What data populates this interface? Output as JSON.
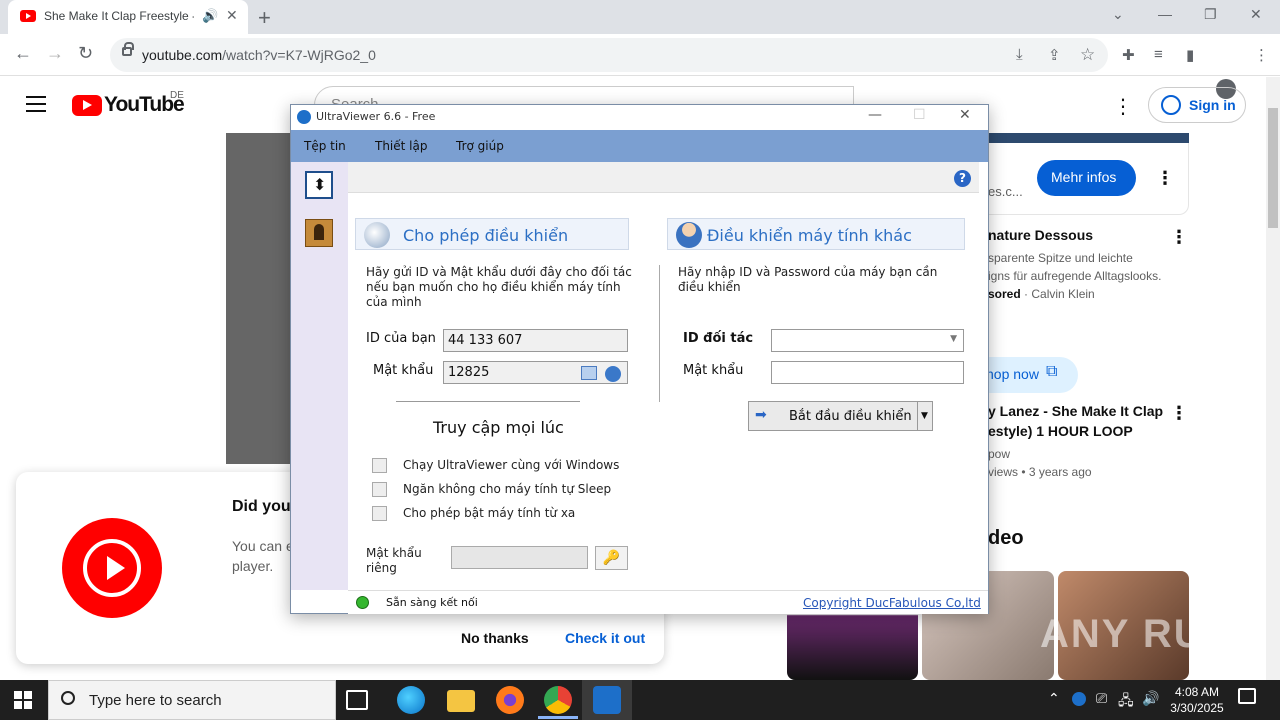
{
  "browser": {
    "tab_title": "She Make It Clap Freestyle -",
    "url_host": "youtube.com",
    "url_path": "/watch?v=K7-WjRGo2_0"
  },
  "youtube": {
    "logo_text": "YouTube",
    "country_code": "DE",
    "search_placeholder": "Search",
    "signin_label": "Sign in"
  },
  "sidebar_right": {
    "ad_button": "Mehr infos",
    "ad_domain": "es.c...",
    "ad2_title": "nature Dessous",
    "ad2_desc_1": "sparente Spitze und leichte",
    "ad2_desc_2": "igns für aufregende Alltagslooks.",
    "ad2_sponsor_prefix": "sored",
    "ad2_sponsor_name": "Calvin Klein",
    "shop_label": "hop now",
    "video_title_1": "y Lanez - She Make It Clap",
    "video_title_2": "estyle) 1 HOUR LOOP",
    "video_channel": "pow",
    "video_meta": "views • 3 years ago",
    "section_heading": "deo"
  },
  "promo": {
    "title": "Did you",
    "desc": "You can e player.",
    "no_thanks": "No thanks",
    "check_it_out": "Check it out"
  },
  "ultraviewer": {
    "window_title": "UltraViewer 6.6 - Free",
    "menu": [
      "Tệp tin",
      "Thiết lập",
      "Trợ giúp"
    ],
    "allow_title": "Cho phép điều khiển",
    "allow_desc": "Hãy gửi ID và Mật khẩu dưới đây cho đối tác nếu bạn muốn cho họ điều khiển máy tính của mình",
    "id_label": "ID của bạn",
    "id_value": "44 133 607",
    "pwd_label": "Mật khẩu",
    "pwd_value": "12825",
    "anytime_title": "Truy cập mọi lúc",
    "options": [
      "Chạy UltraViewer cùng với Windows",
      "Ngăn không cho máy tính tự Sleep",
      "Cho phép bật máy tính từ xa"
    ],
    "private_pwd_label": "Mật khẩu riêng",
    "control_title": "Điều khiển máy tính khác",
    "control_desc": "Hãy nhập ID và Password của máy bạn cần điều khiển",
    "partner_id_label": "ID đối tác",
    "partner_pwd_label": "Mật khẩu",
    "start_button": "Bắt đầu điều khiển",
    "status_text": "Sẵn sàng kết nối",
    "copyright": "Copyright DucFabulous Co,ltd"
  },
  "taskbar": {
    "search_placeholder": "Type here to search",
    "time": "4:08 AM",
    "date": "3/30/2025"
  },
  "watermark": "ANY RUN"
}
